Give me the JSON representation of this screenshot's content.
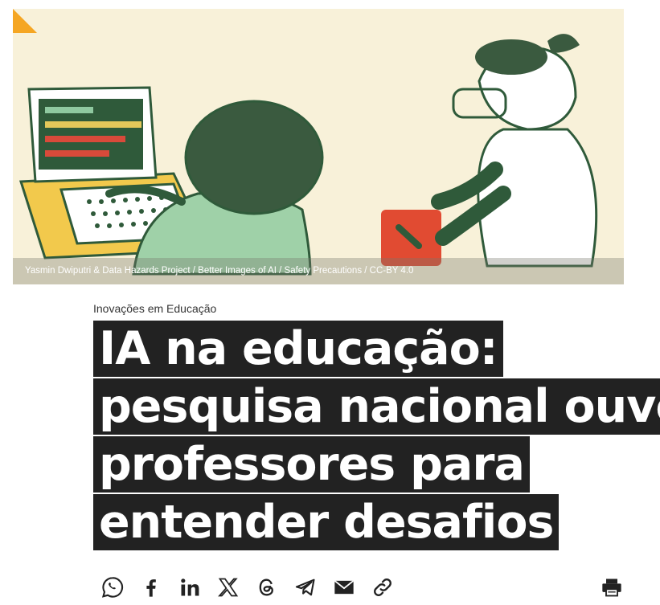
{
  "hero": {
    "caption": "Yasmin Dwiputri & Data Hazards Project / Better Images of AI / Safety Precautions / CC-BY 4.0"
  },
  "article": {
    "category": "Inovações em Educação",
    "title_lines": [
      "IA na educação:",
      "pesquisa nacional ouve",
      "professores para",
      "entender desafios"
    ]
  },
  "share": {
    "buttons": [
      "whatsapp-icon",
      "facebook-icon",
      "linkedin-icon",
      "x-icon",
      "threads-icon",
      "telegram-icon",
      "email-icon",
      "link-icon"
    ],
    "print": "print-icon"
  },
  "colors": {
    "accent": "#f5a623",
    "title_bg": "#222222",
    "illustration_bg": "#f8f1d9",
    "ink_green": "#2f5a3a"
  }
}
